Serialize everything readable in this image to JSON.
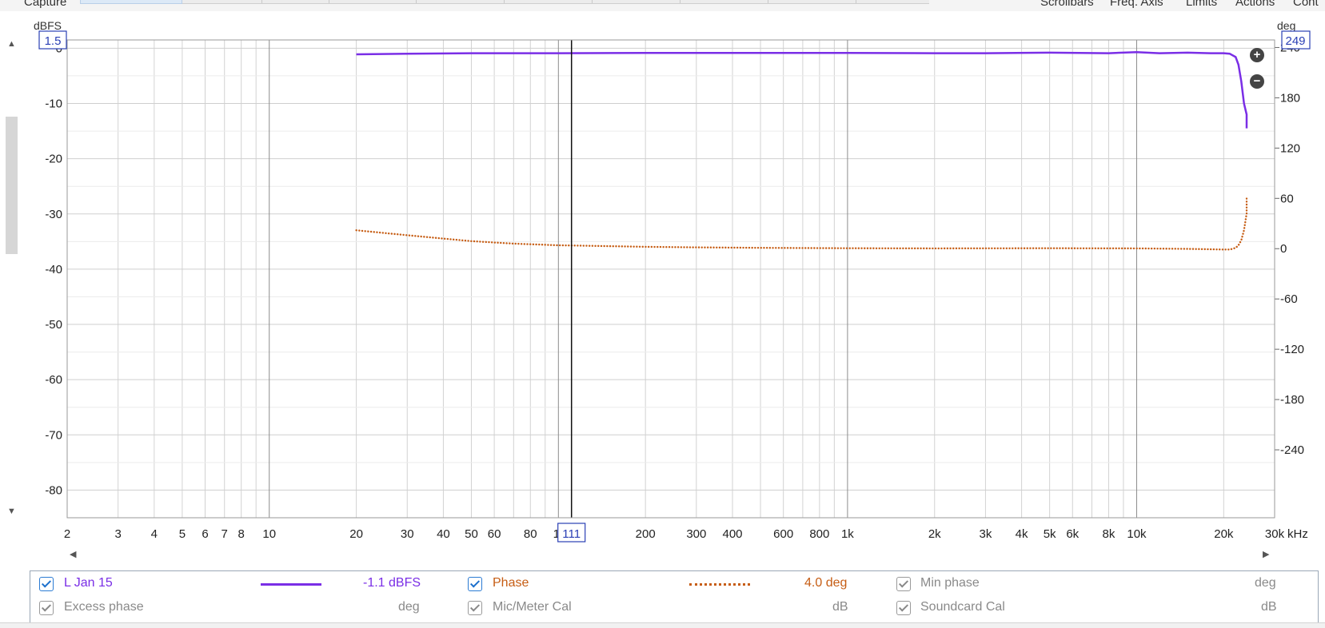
{
  "header": {
    "tab_label": "Capture",
    "menus": [
      "Scrollbars",
      "Freq. Axis",
      "Limits",
      "Actions",
      "Cont"
    ]
  },
  "chart_data": {
    "type": "line",
    "x_scale": "log",
    "xlim": [
      2,
      30000
    ],
    "x_unit": "kHz",
    "x_ticks": [
      {
        "v": 2,
        "label": "2"
      },
      {
        "v": 3,
        "label": "3"
      },
      {
        "v": 4,
        "label": "4"
      },
      {
        "v": 5,
        "label": "5"
      },
      {
        "v": 6,
        "label": "6"
      },
      {
        "v": 7,
        "label": "7"
      },
      {
        "v": 8,
        "label": "8"
      },
      {
        "v": 10,
        "label": "10"
      },
      {
        "v": 20,
        "label": "20"
      },
      {
        "v": 30,
        "label": "30"
      },
      {
        "v": 40,
        "label": "40"
      },
      {
        "v": 50,
        "label": "50"
      },
      {
        "v": 60,
        "label": "60"
      },
      {
        "v": 80,
        "label": "80"
      },
      {
        "v": 100,
        "label": "1("
      },
      {
        "v": 200,
        "label": "200"
      },
      {
        "v": 300,
        "label": "300"
      },
      {
        "v": 400,
        "label": "400"
      },
      {
        "v": 600,
        "label": "600"
      },
      {
        "v": 800,
        "label": "800"
      },
      {
        "v": 1000,
        "label": "1k"
      },
      {
        "v": 2000,
        "label": "2k"
      },
      {
        "v": 3000,
        "label": "3k"
      },
      {
        "v": 4000,
        "label": "4k"
      },
      {
        "v": 5000,
        "label": "5k"
      },
      {
        "v": 6000,
        "label": "6k"
      },
      {
        "v": 8000,
        "label": "8k"
      },
      {
        "v": 10000,
        "label": "10k"
      },
      {
        "v": 20000,
        "label": "20k"
      },
      {
        "v": 30000,
        "label": "30k"
      }
    ],
    "y_left": {
      "unit": "dBFS",
      "lim": [
        -85,
        1.5
      ],
      "top_value_label": "1.5",
      "ticks": [
        0,
        -10,
        -20,
        -30,
        -40,
        -50,
        -60,
        -70,
        -80
      ]
    },
    "y_right": {
      "unit": "deg",
      "lim": [
        -321,
        249
      ],
      "top_value_label": "249",
      "ticks": [
        240,
        180,
        120,
        60,
        0,
        -60,
        -120,
        -180,
        -240
      ]
    },
    "cursor": {
      "x": 111,
      "label": "111"
    },
    "grid": true,
    "series": [
      {
        "name": "L Jan 15",
        "axis": "left",
        "color": "#7a2ee6",
        "style": "solid",
        "points": [
          [
            20,
            -1.1
          ],
          [
            30,
            -1.0
          ],
          [
            50,
            -0.9
          ],
          [
            100,
            -0.9
          ],
          [
            200,
            -0.85
          ],
          [
            500,
            -0.85
          ],
          [
            1000,
            -0.85
          ],
          [
            2000,
            -0.9
          ],
          [
            3000,
            -0.9
          ],
          [
            5000,
            -0.8
          ],
          [
            8000,
            -0.9
          ],
          [
            10000,
            -0.7
          ],
          [
            12000,
            -0.9
          ],
          [
            15000,
            -0.8
          ],
          [
            18000,
            -0.9
          ],
          [
            20000,
            -0.9
          ],
          [
            21000,
            -1.0
          ],
          [
            22000,
            -1.6
          ],
          [
            22500,
            -3.0
          ],
          [
            23000,
            -6.0
          ],
          [
            23500,
            -10.0
          ],
          [
            24000,
            -12.0
          ],
          [
            24000,
            -14.5
          ]
        ]
      },
      {
        "name": "Phase",
        "axis": "right",
        "color": "#c65d14",
        "style": "dotted",
        "points": [
          [
            20,
            22
          ],
          [
            30,
            16
          ],
          [
            40,
            12
          ],
          [
            50,
            9
          ],
          [
            70,
            6
          ],
          [
            100,
            4
          ],
          [
            150,
            3
          ],
          [
            200,
            2.2
          ],
          [
            300,
            1.6
          ],
          [
            500,
            1
          ],
          [
            1000,
            0.5
          ],
          [
            2000,
            0.3
          ],
          [
            5000,
            0.5
          ],
          [
            10000,
            0.3
          ],
          [
            15000,
            -0.3
          ],
          [
            20000,
            -1.0
          ],
          [
            21000,
            -1.0
          ],
          [
            22000,
            1
          ],
          [
            22500,
            4
          ],
          [
            23000,
            10
          ],
          [
            23500,
            22
          ],
          [
            24000,
            42
          ],
          [
            24000,
            62
          ]
        ]
      }
    ]
  },
  "legend": {
    "rows": [
      [
        {
          "label": "L Jan 15",
          "value": "-1.1 dBFS",
          "color": "#7a2ee6",
          "swatch": "solid",
          "checked": true,
          "active": true
        },
        {
          "label": "Phase",
          "value": "4.0 deg",
          "color": "#c65d14",
          "swatch": "dotted",
          "checked": true,
          "active": true
        },
        {
          "label": "Min phase",
          "value": "deg",
          "color": "#8a8a8a",
          "swatch": "none",
          "checked": true,
          "active": false
        }
      ],
      [
        {
          "label": "Excess phase",
          "value": "deg",
          "color": "#8a8a8a",
          "swatch": "none",
          "checked": true,
          "active": false
        },
        {
          "label": "Mic/Meter Cal",
          "value": "dB",
          "color": "#8a8a8a",
          "swatch": "none",
          "checked": true,
          "active": false
        },
        {
          "label": "Soundcard Cal",
          "value": "dB",
          "color": "#8a8a8a",
          "swatch": "none",
          "checked": true,
          "active": false
        }
      ]
    ]
  }
}
